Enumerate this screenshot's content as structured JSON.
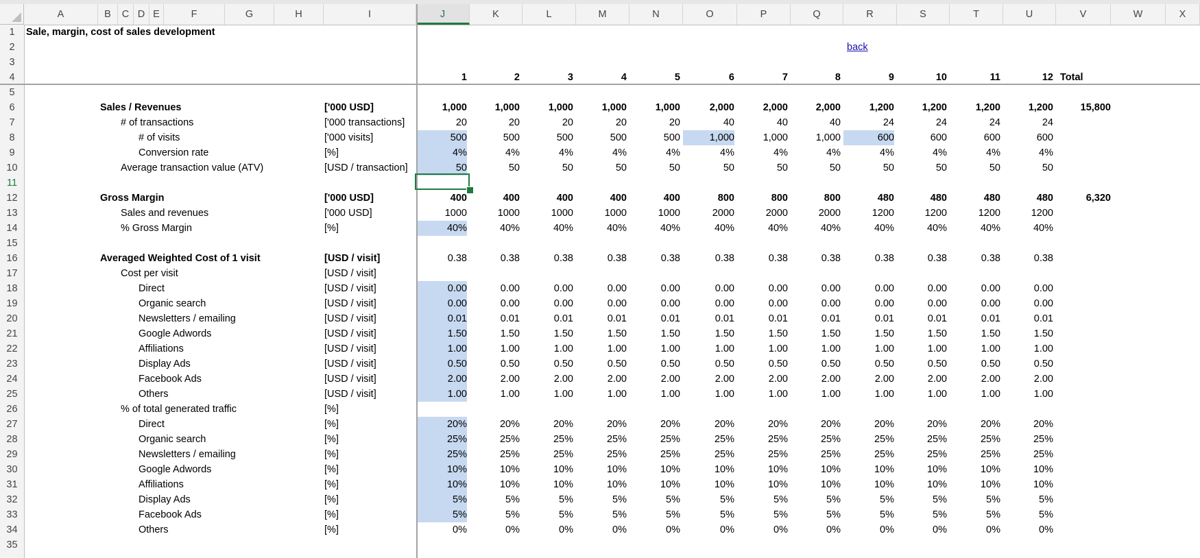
{
  "columns": [
    "A",
    "B",
    "C",
    "D",
    "E",
    "F",
    "G",
    "H",
    "I",
    "J",
    "K",
    "L",
    "M",
    "N",
    "O",
    "P",
    "Q",
    "R",
    "S",
    "T",
    "U",
    "V",
    "W",
    "X"
  ],
  "selected_column": "J",
  "selected_row": 11,
  "rows": [
    "1",
    "2",
    "3",
    "4",
    "5",
    "6",
    "7",
    "8",
    "9",
    "10",
    "11",
    "12",
    "13",
    "14",
    "15",
    "16",
    "17",
    "18",
    "19",
    "20",
    "21",
    "22",
    "23",
    "24",
    "25",
    "26",
    "27",
    "28",
    "29",
    "30",
    "31",
    "32",
    "33",
    "34",
    "35"
  ],
  "title": "Sale, margin, cost of sales development",
  "back_link": "back",
  "months": [
    "1",
    "2",
    "3",
    "4",
    "5",
    "6",
    "7",
    "8",
    "9",
    "10",
    "11",
    "12"
  ],
  "total_label": "Total",
  "highlight_color": "#c6d9f0",
  "selection_color": "#1f7a40",
  "table": [
    {
      "row": 6,
      "label": "Sales / Revenues",
      "indent": 0,
      "bold": true,
      "unit": "['000 USD]",
      "values": [
        "1,000",
        "1,000",
        "1,000",
        "1,000",
        "1,000",
        "2,000",
        "2,000",
        "2,000",
        "1,200",
        "1,200",
        "1,200",
        "1,200"
      ],
      "total": "15,800",
      "hl": []
    },
    {
      "row": 7,
      "label": "# of transactions",
      "indent": 1,
      "bold": false,
      "unit": "['000 transactions]",
      "values": [
        "20",
        "20",
        "20",
        "20",
        "20",
        "40",
        "40",
        "40",
        "24",
        "24",
        "24",
        "24"
      ],
      "total": "",
      "hl": []
    },
    {
      "row": 8,
      "label": "# of visits",
      "indent": 2,
      "bold": false,
      "unit": "['000 visits]",
      "values": [
        "500",
        "500",
        "500",
        "500",
        "500",
        "1,000",
        "1,000",
        "1,000",
        "600",
        "600",
        "600",
        "600"
      ],
      "total": "",
      "hl": [
        0,
        5,
        8
      ]
    },
    {
      "row": 9,
      "label": "Conversion rate",
      "indent": 2,
      "bold": false,
      "unit": "[%]",
      "values": [
        "4%",
        "4%",
        "4%",
        "4%",
        "4%",
        "4%",
        "4%",
        "4%",
        "4%",
        "4%",
        "4%",
        "4%"
      ],
      "total": "",
      "hl": [
        0
      ]
    },
    {
      "row": 10,
      "label": "Average transaction value (ATV)",
      "indent": 1,
      "bold": false,
      "unit": "[USD / transaction]",
      "values": [
        "50",
        "50",
        "50",
        "50",
        "50",
        "50",
        "50",
        "50",
        "50",
        "50",
        "50",
        "50"
      ],
      "total": "",
      "hl": [
        0
      ]
    },
    {
      "row": 12,
      "label": "Gross Margin",
      "indent": 0,
      "bold": true,
      "unit": "['000 USD]",
      "values": [
        "400",
        "400",
        "400",
        "400",
        "400",
        "800",
        "800",
        "800",
        "480",
        "480",
        "480",
        "480"
      ],
      "total": "6,320",
      "hl": []
    },
    {
      "row": 13,
      "label": "Sales and revenues",
      "indent": 1,
      "bold": false,
      "unit": "['000 USD]",
      "values": [
        "1000",
        "1000",
        "1000",
        "1000",
        "1000",
        "2000",
        "2000",
        "2000",
        "1200",
        "1200",
        "1200",
        "1200"
      ],
      "total": "",
      "hl": []
    },
    {
      "row": 14,
      "label": "% Gross Margin",
      "indent": 1,
      "bold": false,
      "unit": "[%]",
      "values": [
        "40%",
        "40%",
        "40%",
        "40%",
        "40%",
        "40%",
        "40%",
        "40%",
        "40%",
        "40%",
        "40%",
        "40%"
      ],
      "total": "",
      "hl": [
        0
      ]
    },
    {
      "row": 16,
      "label": "Averaged Weighted Cost of 1 visit",
      "indent": 0,
      "bold": true,
      "unit": "[USD / visit]",
      "values": [
        "0.38",
        "0.38",
        "0.38",
        "0.38",
        "0.38",
        "0.38",
        "0.38",
        "0.38",
        "0.38",
        "0.38",
        "0.38",
        "0.38"
      ],
      "total": "",
      "hl": [],
      "vbold": false
    },
    {
      "row": 17,
      "label": "Cost per visit",
      "indent": 1,
      "bold": false,
      "unit": "[USD / visit]",
      "values": [],
      "total": "",
      "hl": []
    },
    {
      "row": 18,
      "label": "Direct",
      "indent": 2,
      "bold": false,
      "unit": "[USD / visit]",
      "values": [
        "0.00",
        "0.00",
        "0.00",
        "0.00",
        "0.00",
        "0.00",
        "0.00",
        "0.00",
        "0.00",
        "0.00",
        "0.00",
        "0.00"
      ],
      "total": "",
      "hl": [
        0
      ]
    },
    {
      "row": 19,
      "label": "Organic search",
      "indent": 2,
      "bold": false,
      "unit": "[USD / visit]",
      "values": [
        "0.00",
        "0.00",
        "0.00",
        "0.00",
        "0.00",
        "0.00",
        "0.00",
        "0.00",
        "0.00",
        "0.00",
        "0.00",
        "0.00"
      ],
      "total": "",
      "hl": [
        0
      ]
    },
    {
      "row": 20,
      "label": "Newsletters / emailing",
      "indent": 2,
      "bold": false,
      "unit": "[USD / visit]",
      "values": [
        "0.01",
        "0.01",
        "0.01",
        "0.01",
        "0.01",
        "0.01",
        "0.01",
        "0.01",
        "0.01",
        "0.01",
        "0.01",
        "0.01"
      ],
      "total": "",
      "hl": [
        0
      ]
    },
    {
      "row": 21,
      "label": "Google Adwords",
      "indent": 2,
      "bold": false,
      "unit": "[USD / visit]",
      "values": [
        "1.50",
        "1.50",
        "1.50",
        "1.50",
        "1.50",
        "1.50",
        "1.50",
        "1.50",
        "1.50",
        "1.50",
        "1.50",
        "1.50"
      ],
      "total": "",
      "hl": [
        0
      ]
    },
    {
      "row": 22,
      "label": "Affiliations",
      "indent": 2,
      "bold": false,
      "unit": "[USD / visit]",
      "values": [
        "1.00",
        "1.00",
        "1.00",
        "1.00",
        "1.00",
        "1.00",
        "1.00",
        "1.00",
        "1.00",
        "1.00",
        "1.00",
        "1.00"
      ],
      "total": "",
      "hl": [
        0
      ]
    },
    {
      "row": 23,
      "label": "Display Ads",
      "indent": 2,
      "bold": false,
      "unit": "[USD / visit]",
      "values": [
        "0.50",
        "0.50",
        "0.50",
        "0.50",
        "0.50",
        "0.50",
        "0.50",
        "0.50",
        "0.50",
        "0.50",
        "0.50",
        "0.50"
      ],
      "total": "",
      "hl": [
        0
      ]
    },
    {
      "row": 24,
      "label": "Facebook Ads",
      "indent": 2,
      "bold": false,
      "unit": "[USD / visit]",
      "values": [
        "2.00",
        "2.00",
        "2.00",
        "2.00",
        "2.00",
        "2.00",
        "2.00",
        "2.00",
        "2.00",
        "2.00",
        "2.00",
        "2.00"
      ],
      "total": "",
      "hl": [
        0
      ]
    },
    {
      "row": 25,
      "label": "Others",
      "indent": 2,
      "bold": false,
      "unit": "[USD / visit]",
      "values": [
        "1.00",
        "1.00",
        "1.00",
        "1.00",
        "1.00",
        "1.00",
        "1.00",
        "1.00",
        "1.00",
        "1.00",
        "1.00",
        "1.00"
      ],
      "total": "",
      "hl": [
        0
      ]
    },
    {
      "row": 26,
      "label": "% of total generated traffic",
      "indent": 1,
      "bold": false,
      "unit": "[%]",
      "values": [],
      "total": "",
      "hl": []
    },
    {
      "row": 27,
      "label": "Direct",
      "indent": 2,
      "bold": false,
      "unit": "[%]",
      "values": [
        "20%",
        "20%",
        "20%",
        "20%",
        "20%",
        "20%",
        "20%",
        "20%",
        "20%",
        "20%",
        "20%",
        "20%"
      ],
      "total": "",
      "hl": [
        0
      ]
    },
    {
      "row": 28,
      "label": "Organic search",
      "indent": 2,
      "bold": false,
      "unit": "[%]",
      "values": [
        "25%",
        "25%",
        "25%",
        "25%",
        "25%",
        "25%",
        "25%",
        "25%",
        "25%",
        "25%",
        "25%",
        "25%"
      ],
      "total": "",
      "hl": [
        0
      ]
    },
    {
      "row": 29,
      "label": "Newsletters / emailing",
      "indent": 2,
      "bold": false,
      "unit": "[%]",
      "values": [
        "25%",
        "25%",
        "25%",
        "25%",
        "25%",
        "25%",
        "25%",
        "25%",
        "25%",
        "25%",
        "25%",
        "25%"
      ],
      "total": "",
      "hl": [
        0
      ]
    },
    {
      "row": 30,
      "label": "Google Adwords",
      "indent": 2,
      "bold": false,
      "unit": "[%]",
      "values": [
        "10%",
        "10%",
        "10%",
        "10%",
        "10%",
        "10%",
        "10%",
        "10%",
        "10%",
        "10%",
        "10%",
        "10%"
      ],
      "total": "",
      "hl": [
        0
      ]
    },
    {
      "row": 31,
      "label": "Affiliations",
      "indent": 2,
      "bold": false,
      "unit": "[%]",
      "values": [
        "10%",
        "10%",
        "10%",
        "10%",
        "10%",
        "10%",
        "10%",
        "10%",
        "10%",
        "10%",
        "10%",
        "10%"
      ],
      "total": "",
      "hl": [
        0
      ]
    },
    {
      "row": 32,
      "label": "Display Ads",
      "indent": 2,
      "bold": false,
      "unit": "[%]",
      "values": [
        "5%",
        "5%",
        "5%",
        "5%",
        "5%",
        "5%",
        "5%",
        "5%",
        "5%",
        "5%",
        "5%",
        "5%"
      ],
      "total": "",
      "hl": [
        0
      ]
    },
    {
      "row": 33,
      "label": "Facebook Ads",
      "indent": 2,
      "bold": false,
      "unit": "[%]",
      "values": [
        "5%",
        "5%",
        "5%",
        "5%",
        "5%",
        "5%",
        "5%",
        "5%",
        "5%",
        "5%",
        "5%",
        "5%"
      ],
      "total": "",
      "hl": [
        0
      ]
    },
    {
      "row": 34,
      "label": "Others",
      "indent": 2,
      "bold": false,
      "unit": "[%]",
      "values": [
        "0%",
        "0%",
        "0%",
        "0%",
        "0%",
        "0%",
        "0%",
        "0%",
        "0%",
        "0%",
        "0%",
        "0%"
      ],
      "total": "",
      "hl": []
    }
  ]
}
